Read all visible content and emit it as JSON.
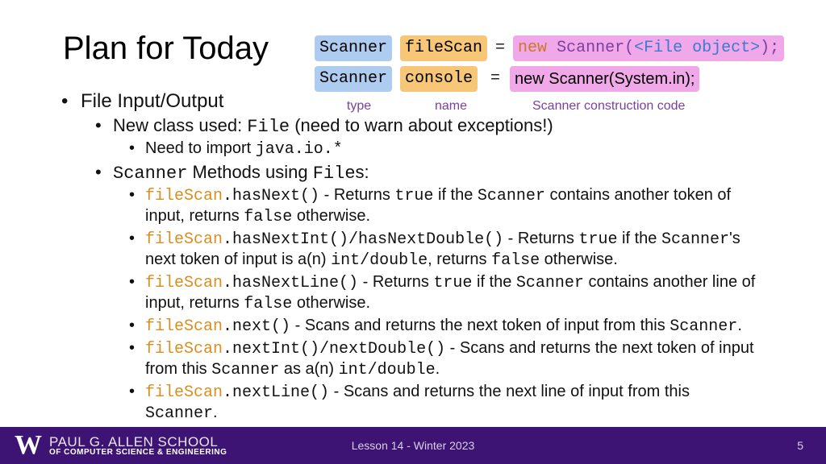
{
  "title": "Plan for Today",
  "code": {
    "r1": {
      "type": "Scanner",
      "name": "fileScan",
      "eq": "=",
      "rest_new": "new",
      "rest_fn": "Scanner(",
      "rest_arg": "<File object>",
      "rest_close": ");"
    },
    "r2": {
      "type": "Scanner",
      "name": "console",
      "eq": "=",
      "rest": "new Scanner(System.in);"
    },
    "labels": {
      "type": "type",
      "name": "name",
      "con": "Scanner construction code"
    }
  },
  "b": {
    "l1": "File Input/Output",
    "l2a_pre": "New class used: ",
    "l2a_code": "File",
    "l2a_post": " (need to warn about exceptions!)",
    "l3a_pre": "Need to import ",
    "l3a_code": "java.io.*",
    "l2b_code": "Scanner",
    "l2b_mid": " Methods using ",
    "l2b_code2": "File",
    "l2b_post": "s:",
    "m1_fs": "fileScan",
    "m1_dot": ".",
    "m1_m": "hasNext()",
    "m1_t1": " - Returns ",
    "m1_true": "true",
    "m1_t2": " if the ",
    "m1_sc": "Scanner",
    "m1_t3": " contains another token of input, returns ",
    "m1_false": "false",
    "m1_t4": " otherwise.",
    "m2_m": "hasNextInt()/hasNextDouble()",
    "m2_t1": " - Returns ",
    "m2_true": "true",
    "m2_t2": " if the ",
    "m2_sc": "Scanner",
    "m2_t3": "'s next token of input is a(n) ",
    "m2_id": "int/double",
    "m2_t4": ", returns ",
    "m2_false": "false",
    "m2_t5": " otherwise.",
    "m3_m": "hasNextLine()",
    "m3_t1": " - Returns ",
    "m3_true": "true",
    "m3_t2": " if the ",
    "m3_sc": "Scanner",
    "m3_t3": " contains another line of input, returns ",
    "m3_false": "false",
    "m3_t4": " otherwise.",
    "m4_m": "next()",
    "m4_t1": " - Scans and returns the next token of input from this ",
    "m4_sc": "Scanner",
    "m4_t2": ".",
    "m5_m": "nextInt()/nextDouble()",
    "m5_t1": " - Scans and returns the next token of input from this ",
    "m5_sc": "Scanner",
    "m5_t2": " as a(n) ",
    "m5_id": "int/double",
    "m5_t3": ".",
    "m6_m": "nextLine()",
    "m6_t1": " - Scans and returns the next line of input from this ",
    "m6_sc": "Scanner",
    "m6_t2": "."
  },
  "footer": {
    "school_main": "PAUL G. ALLEN SCHOOL",
    "school_sub": "OF COMPUTER SCIENCE & ENGINEERING",
    "center": "Lesson 14 - Winter 2023",
    "page": "5",
    "W": "W"
  }
}
